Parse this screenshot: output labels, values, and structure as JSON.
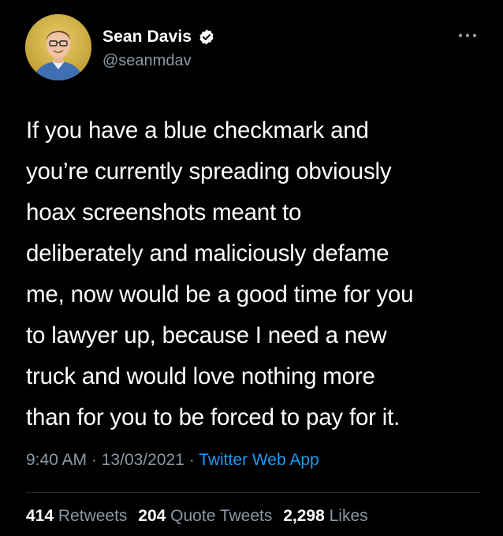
{
  "author": {
    "display_name": "Sean Davis",
    "handle": "@seanmdav",
    "verified": true
  },
  "tweet": {
    "text": "If you have a blue checkmark and\nyou’re  currently spreading obviously\nhoax screenshots meant to\ndeliberately and maliciously defame\nme, now would be a good time for you\nto lawyer up, because I need a new\ntruck and would love nothing more\nthan for you to be forced to pay for it.",
    "time": "9:40 AM",
    "date": "13/03/2021",
    "separator": "·",
    "source": "Twitter Web App"
  },
  "stats": {
    "retweets_count": "414",
    "retweets_label": "Retweets",
    "quote_count": "204",
    "quote_label": "Quote Tweets",
    "likes_count": "2,298",
    "likes_label": "Likes"
  },
  "icons": {
    "verified": "verified-badge-icon",
    "more": "more-options-icon"
  },
  "colors": {
    "background": "#000000",
    "primary_text": "#ffffff",
    "secondary_text": "#8b98a5",
    "link": "#1d9bf0",
    "divider": "#2f3336"
  }
}
